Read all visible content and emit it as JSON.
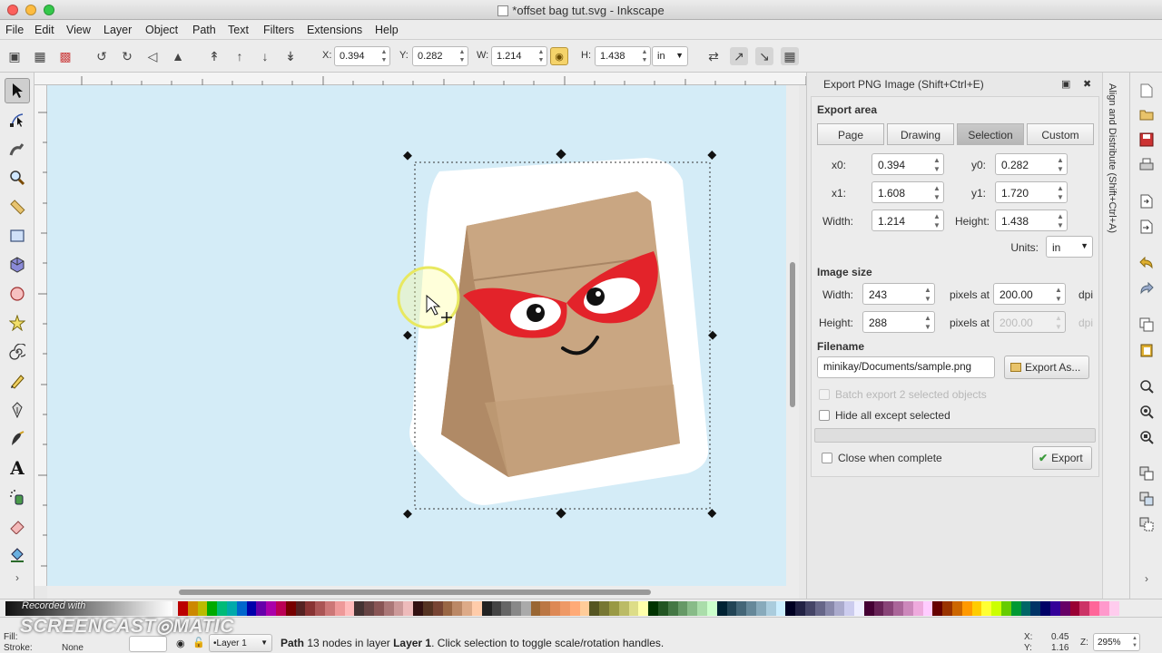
{
  "window": {
    "title": "*offset bag tut.svg - Inkscape"
  },
  "menu": [
    "File",
    "Edit",
    "View",
    "Layer",
    "Object",
    "Path",
    "Text",
    "Filters",
    "Extensions",
    "Help"
  ],
  "toolbar": {
    "x_label": "X:",
    "x_value": "0.394",
    "y_label": "Y:",
    "y_value": "0.282",
    "w_label": "W:",
    "w_value": "1.214",
    "h_label": "H:",
    "h_value": "1.438",
    "units": "in"
  },
  "dialog": {
    "title": "Export PNG Image (Shift+Ctrl+E)",
    "export_area_label": "Export area",
    "area_buttons": [
      "Page",
      "Drawing",
      "Selection",
      "Custom"
    ],
    "selected_area": "Selection",
    "x0_label": "x0:",
    "x0": "0.394",
    "y0_label": "y0:",
    "y0": "0.282",
    "x1_label": "x1:",
    "x1": "1.608",
    "y1_label": "y1:",
    "y1": "1.720",
    "width_label": "Width:",
    "width": "1.214",
    "height_label": "Height:",
    "height": "1.438",
    "units_label": "Units:",
    "units": "in",
    "image_size_label": "Image size",
    "img_width_label": "Width:",
    "img_width": "243",
    "img_height_label": "Height:",
    "img_height": "288",
    "pixels_at": "pixels at",
    "dpi_x": "200.00",
    "dpi_y": "200.00",
    "dpi": "dpi",
    "filename_label": "Filename",
    "filename": "minikay/Documents/sample.png",
    "export_as": "Export As...",
    "batch_export": "Batch export 2 selected objects",
    "hide_all": "Hide all except selected",
    "close_when_complete": "Close when complete",
    "export": "Export"
  },
  "side_tab": "Align and Distribute (Shift+Ctrl+A)",
  "statusbar": {
    "fill_label": "Fill:",
    "stroke_label": "Stroke:",
    "stroke_value": "None",
    "layer": "•Layer 1",
    "message_bold": "Path",
    "message_1": " 13 nodes in layer ",
    "message_layer": "Layer 1",
    "message_2": ". Click selection to toggle scale/rotation handles.",
    "x_label": "X:",
    "x": "0.45",
    "y_label": "Y:",
    "y": "1.16",
    "z_label": "Z:",
    "zoom": "295%"
  },
  "watermark": {
    "small": "Recorded with",
    "big": "SCREENCAST◎MATIC"
  },
  "colors": {
    "canvas": "#d4ecf7",
    "glasses": "#e3232a",
    "bag": "#c9a682",
    "bag_shadow": "#b08a66"
  }
}
